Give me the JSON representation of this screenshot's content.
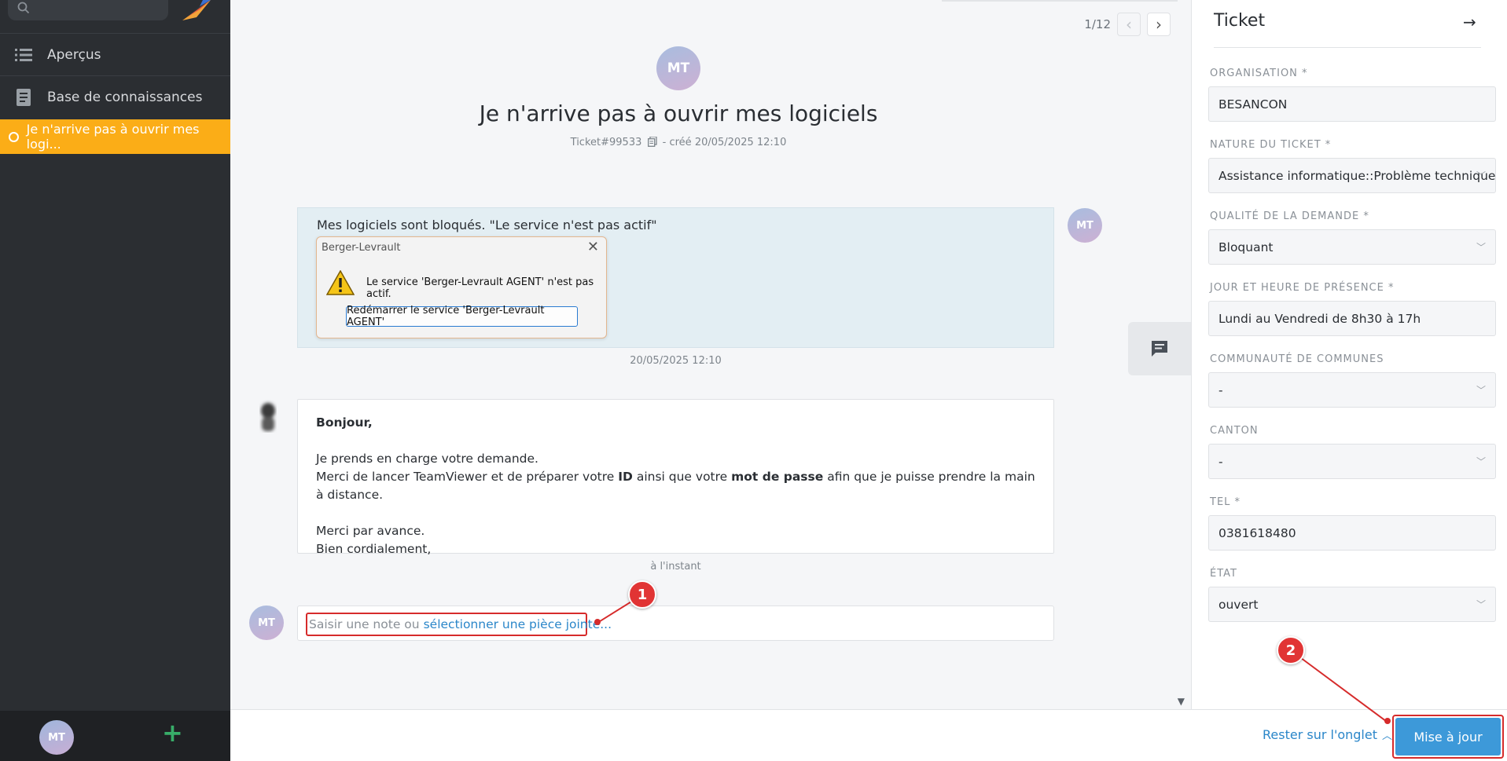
{
  "sidebar": {
    "nav_overview": "Aperçus",
    "nav_knowledge": "Base de connaissances",
    "active_ticket": "Je n'arrive pas à ouvrir mes logi...",
    "user_initials": "MT",
    "add_symbol": "+"
  },
  "header": {
    "pager_text": "1/12",
    "avatar_initials": "MT",
    "title": "Je n'arrive pas à ouvrir mes logiciels",
    "ticket_number": "Ticket#99533",
    "created": "- créé 20/05/2025 12:10"
  },
  "article1": {
    "text": "Mes logiciels sont bloqués. \"Le service n'est pas actif\"",
    "dialog_title": "Berger-Levrault",
    "dialog_message": "Le service 'Berger-Levrault AGENT' n'est pas actif.",
    "dialog_button": "Redémarrer le service 'Berger-Levrault AGENT'",
    "avatar_initials": "MT",
    "timestamp": "20/05/2025 12:10"
  },
  "article2": {
    "greeting": "Bonjour,",
    "line1": "Je prends en charge votre demande.",
    "line2_a": "Merci de lancer TeamViewer et de préparer votre ",
    "line2_b": "ID",
    "line2_c": " ainsi que votre ",
    "line2_d": "mot de passe",
    "line2_e": " afin que je puisse prendre la main à distance.",
    "line3": "Merci par avance.",
    "line4": "Bien cordialement,",
    "timestamp": "à l'instant"
  },
  "reply": {
    "avatar_initials": "MT",
    "placeholder": "Saisir une note ou",
    "attach_link": "sélectionner une pièce jointe..."
  },
  "annotations": {
    "badge1": "1",
    "badge2": "2"
  },
  "bottom": {
    "stay_label": "Rester sur l'onglet",
    "update_label": "Mise à jour"
  },
  "ticket_panel": {
    "title": "Ticket",
    "fields": [
      {
        "label": "ORGANISATION *",
        "value": "BESANCON"
      },
      {
        "label": "NATURE DU TICKET *",
        "value": "Assistance informatique::Problème technique::"
      },
      {
        "label": "QUALITÉ DE LA DEMANDE *",
        "value": "Bloquant"
      },
      {
        "label": "JOUR ET HEURE DE PRÉSENCE *",
        "value": "Lundi au Vendredi de 8h30 à 17h"
      },
      {
        "label": "COMMUNAUTÉ DE COMMUNES",
        "value": "-"
      },
      {
        "label": "CANTON",
        "value": "-"
      },
      {
        "label": "TEL *",
        "value": "0381618480"
      },
      {
        "label": "ÉTAT",
        "value": "ouvert"
      }
    ]
  },
  "colors": {
    "sidebar_bg": "#2b2e32",
    "active_accent": "#fbad17",
    "primary_button": "#3d99d9",
    "link": "#2a86c9",
    "annotation_red": "#d62b2b"
  }
}
